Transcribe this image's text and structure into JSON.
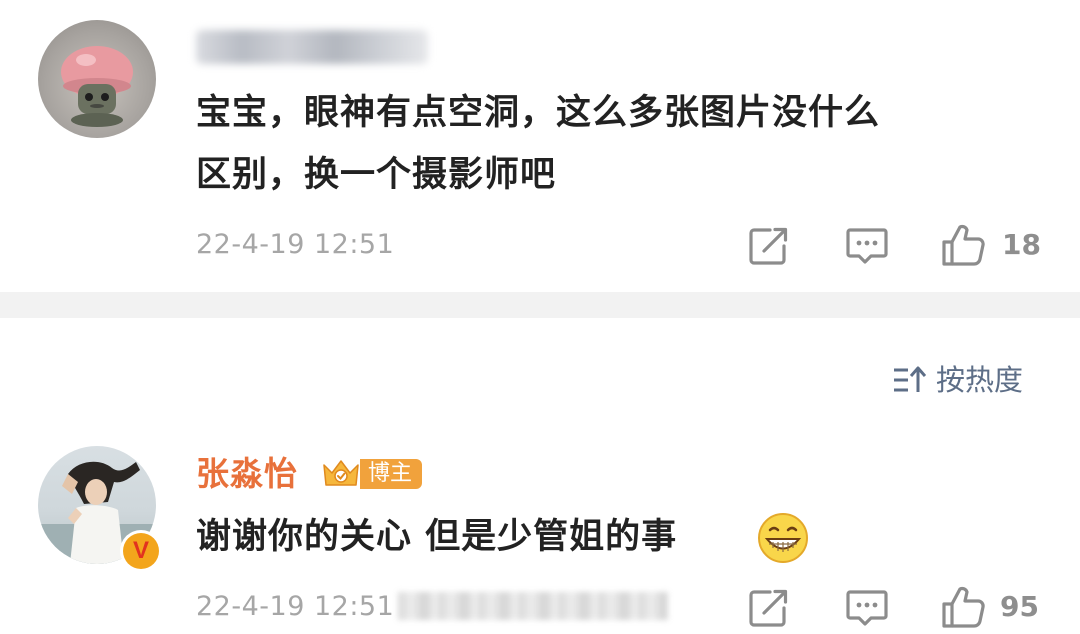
{
  "comment1": {
    "avatar_icon": "mushroom-figurine-avatar",
    "username_obscured": true,
    "text_line1": "宝宝，眼神有点空洞，这么多张图片没什么",
    "text_line2": "区别，换一个摄影师吧",
    "timestamp": "22-4-19 12:51",
    "actions": {
      "share_icon": "share-icon",
      "reply_icon": "reply-icon",
      "like_icon": "thumbs-up-icon",
      "like_count": "18"
    }
  },
  "sort": {
    "icon": "sort-icon",
    "label": "按热度"
  },
  "comment2": {
    "author": "张淼怡",
    "badge_label": "博主",
    "verified_icon": "verified-v-icon",
    "verified_letter": "V",
    "text": "谢谢你的关心 但是少管姐的事",
    "emoji": "grinning-emoji",
    "timestamp": "22-4-19 12:51",
    "actions": {
      "share_icon": "share-icon",
      "reply_icon": "reply-icon",
      "like_icon": "thumbs-up-icon",
      "like_count": "95"
    }
  },
  "colors": {
    "text_primary": "#222222",
    "timestamp": "#a6a6a6",
    "author_name": "#e8713b",
    "badge_orange": "#f1a23c",
    "sort_label": "#5d6e87",
    "divider": "#f2f2f2"
  }
}
